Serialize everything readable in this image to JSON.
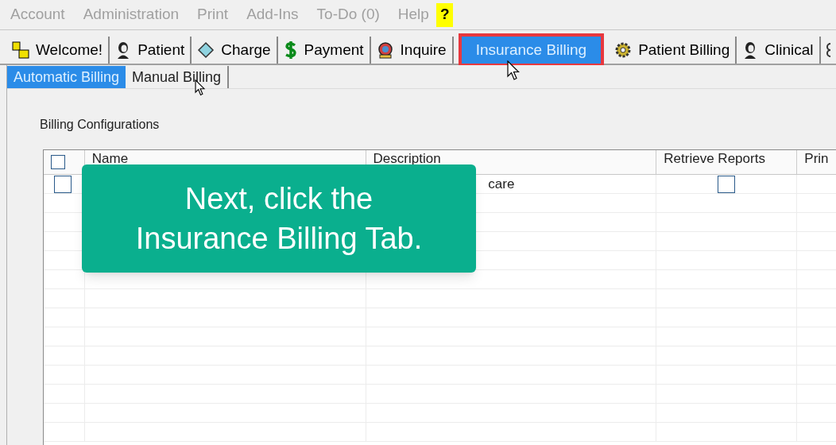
{
  "menu": [
    {
      "label": "Account"
    },
    {
      "label": "Administration"
    },
    {
      "label": "Print"
    },
    {
      "label": "Add-Ins"
    },
    {
      "label": "To-Do (0)"
    },
    {
      "label": "Help"
    }
  ],
  "help_button": "?",
  "tabs": [
    {
      "label": "Welcome!",
      "kind": "pm",
      "selected": false,
      "highlighted": false
    },
    {
      "label": "Patient",
      "kind": "person",
      "selected": false,
      "highlighted": false
    },
    {
      "label": "Charge",
      "kind": "diamond",
      "selected": false,
      "highlighted": false
    },
    {
      "label": "Payment",
      "kind": "dollar",
      "selected": false,
      "highlighted": false
    },
    {
      "label": "Inquire",
      "kind": "globe",
      "selected": false,
      "highlighted": false
    },
    {
      "label": "Insurance Billing",
      "kind": "none",
      "selected": true,
      "highlighted": true
    },
    {
      "label": "Patient Billing",
      "kind": "gear",
      "selected": false,
      "highlighted": false
    },
    {
      "label": "Clinical",
      "kind": "person",
      "selected": false,
      "highlighted": false
    }
  ],
  "subtabs": [
    {
      "label": "Automatic Billing",
      "selected": true
    },
    {
      "label": "Manual Billing",
      "selected": false
    }
  ],
  "section_title": "Billing Configurations",
  "table": {
    "select_all_checked": false,
    "columns": [
      "Name",
      "Description",
      "Retrieve Reports",
      "Prin"
    ],
    "rows": [
      {
        "selected": false,
        "description": "care",
        "retrieve_reports": false
      }
    ]
  },
  "callout": "Next, click the Insurance Billing Tab."
}
